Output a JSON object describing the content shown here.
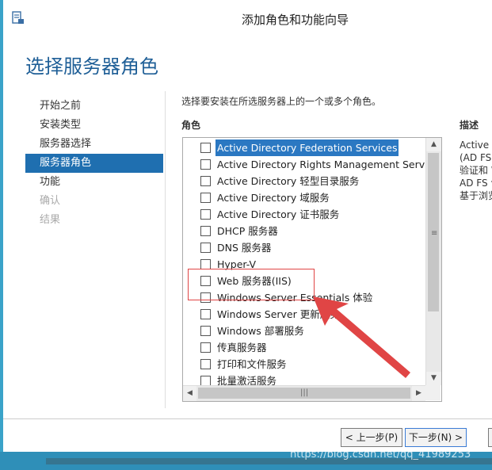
{
  "window": {
    "title": "添加角色和功能向导"
  },
  "page": {
    "title": "选择服务器角色"
  },
  "nav": {
    "items": [
      {
        "label": "开始之前",
        "state": "normal"
      },
      {
        "label": "安装类型",
        "state": "normal"
      },
      {
        "label": "服务器选择",
        "state": "normal"
      },
      {
        "label": "服务器角色",
        "state": "active"
      },
      {
        "label": "功能",
        "state": "normal"
      },
      {
        "label": "确认",
        "state": "disabled"
      },
      {
        "label": "结果",
        "state": "disabled"
      }
    ]
  },
  "content": {
    "instruction": "选择要安装在所选服务器上的一个或多个角色。",
    "roles_label": "角色",
    "description_label": "描述",
    "description_lines": [
      "Active D",
      "(AD FS)",
      "验证和 W",
      "AD FS 包",
      "基于浏览"
    ]
  },
  "roles": [
    {
      "label": "Active Directory Federation Services",
      "checked": false,
      "selected": true
    },
    {
      "label": "Active Directory Rights Management Services",
      "checked": false,
      "selected": false
    },
    {
      "label": "Active Directory 轻型目录服务",
      "checked": false,
      "selected": false
    },
    {
      "label": "Active Directory 域服务",
      "checked": false,
      "selected": false
    },
    {
      "label": "Active Directory 证书服务",
      "checked": false,
      "selected": false
    },
    {
      "label": "DHCP 服务器",
      "checked": false,
      "selected": false
    },
    {
      "label": "DNS 服务器",
      "checked": false,
      "selected": false
    },
    {
      "label": "Hyper-V",
      "checked": false,
      "selected": false
    },
    {
      "label": "Web 服务器(IIS)",
      "checked": false,
      "selected": false
    },
    {
      "label": "Windows Server Essentials 体验",
      "checked": false,
      "selected": false
    },
    {
      "label": "Windows Server 更新服务",
      "checked": false,
      "selected": false
    },
    {
      "label": "Windows 部署服务",
      "checked": false,
      "selected": false
    },
    {
      "label": "传真服务器",
      "checked": false,
      "selected": false
    },
    {
      "label": "打印和文件服务",
      "checked": false,
      "selected": false
    },
    {
      "label": "批量激活服务",
      "checked": false,
      "selected": false
    }
  ],
  "buttons": {
    "prev": "< 上一步(P)",
    "next": "下一步(N) >"
  },
  "watermark": "https://blog.csdn.net/qq_41989253",
  "colors": {
    "accent": "#1f6fb0",
    "title": "#1f5f97",
    "annotation": "#e04545",
    "frame": "#3aa3c9"
  },
  "icons": {
    "app": "server-manager-icon",
    "scroll_up": "chevron-up-icon",
    "scroll_down": "chevron-down-icon",
    "scroll_left": "chevron-left-icon",
    "scroll_right": "chevron-right-icon"
  }
}
